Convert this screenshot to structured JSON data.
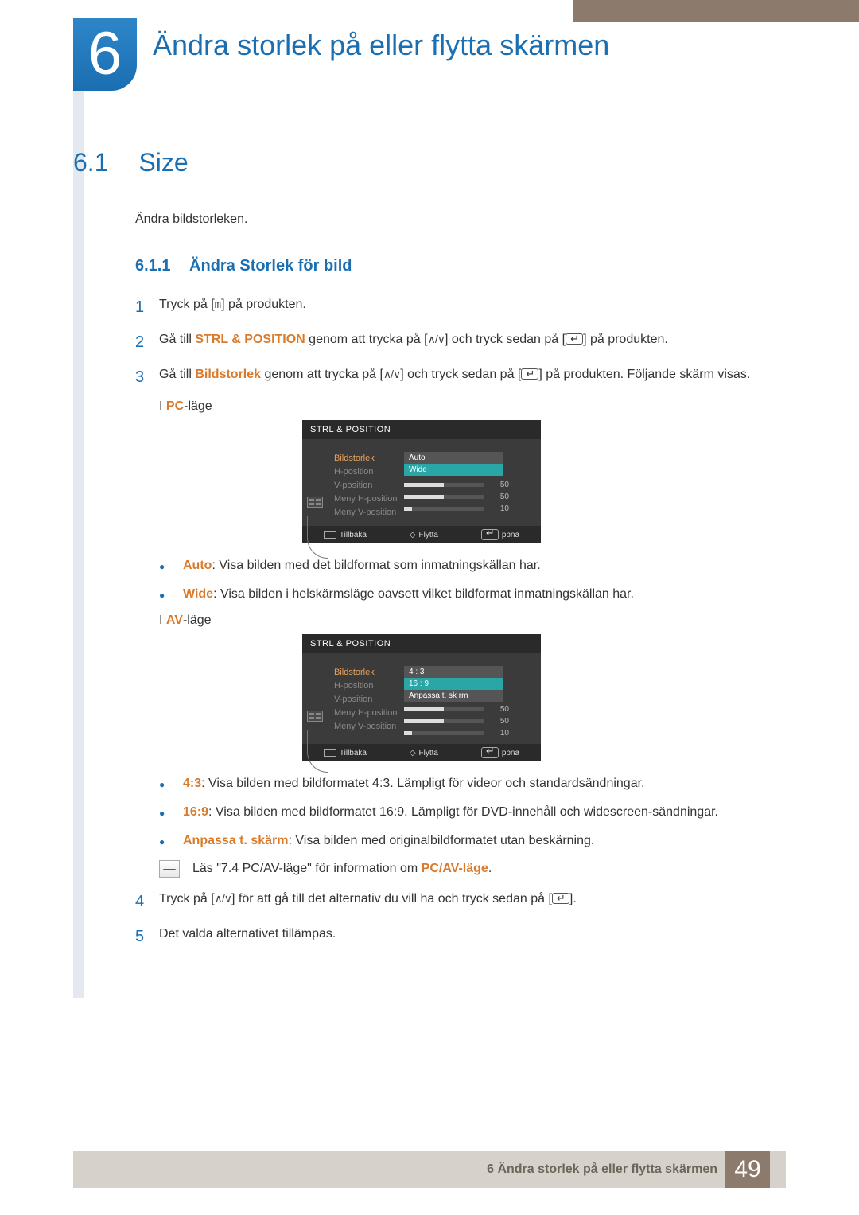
{
  "chapter": {
    "number": "6",
    "title": "Ändra storlek på eller flytta skärmen"
  },
  "section": {
    "number": "6.1",
    "title": "Size",
    "intro": "Ändra bildstorleken."
  },
  "subsection": {
    "number": "6.1.1",
    "title": "Ändra Storlek för bild"
  },
  "steps": {
    "s1": {
      "num": "1",
      "pre": "Tryck på [",
      "key": "m",
      "post": "] på produkten."
    },
    "s2": {
      "num": "2",
      "pre": "Gå till ",
      "hl": "STRL & POSITION",
      "mid": " genom att trycka på [",
      "mid2": "] och tryck sedan på [",
      "post": "] på produkten."
    },
    "s3": {
      "num": "3",
      "pre": "Gå till ",
      "hl": "Bildstorlek",
      "mid": " genom att trycka på [",
      "mid2": "] och tryck sedan på [",
      "post": "] på produkten. Följande skärm visas."
    },
    "mode_pc_pre": "I ",
    "mode_pc_hl": "PC",
    "mode_pc_post": "-läge",
    "mode_av_pre": "I ",
    "mode_av_hl": "AV",
    "mode_av_post": "-läge",
    "s4": {
      "num": "4",
      "pre": "Tryck på [",
      "mid": "] för att gå till det alternativ du vill ha och tryck sedan på [",
      "post": "]."
    },
    "s5": {
      "num": "5",
      "text": "Det valda alternativet tillämpas."
    }
  },
  "osd_pc": {
    "title": "STRL & POSITION",
    "labels": [
      "Bildstorlek",
      "H-position",
      "V-position",
      "Meny H-position",
      "Meny V-position"
    ],
    "options": [
      "Auto",
      "Wide"
    ],
    "sliders": [
      {
        "fill": 50,
        "val": "50"
      },
      {
        "fill": 50,
        "val": "50"
      },
      {
        "fill": 10,
        "val": "10"
      }
    ],
    "footer": [
      "Tillbaka",
      "Flytta",
      "ppna"
    ]
  },
  "osd_av": {
    "title": "STRL & POSITION",
    "labels": [
      "Bildstorlek",
      "H-position",
      "V-position",
      "Meny H-position",
      "Meny V-position"
    ],
    "options": [
      "4 : 3",
      "16 : 9",
      "Anpassa t. sk rm"
    ],
    "sliders": [
      {
        "fill": 50,
        "val": "50"
      },
      {
        "fill": 50,
        "val": "50"
      },
      {
        "fill": 10,
        "val": "10"
      }
    ],
    "footer": [
      "Tillbaka",
      "Flytta",
      "ppna"
    ]
  },
  "bullets_pc": {
    "b1": {
      "hl": "Auto",
      "text": ": Visa bilden med det bildformat som inmatningskällan har."
    },
    "b2": {
      "hl": "Wide",
      "text": ": Visa bilden i helskärmsläge oavsett vilket bildformat inmatningskällan har."
    }
  },
  "bullets_av": {
    "b1": {
      "hl": "4:3",
      "text": ": Visa bilden med bildformatet 4:3. Lämpligt för videor och standardsändningar."
    },
    "b2": {
      "hl": "16:9",
      "text": ": Visa bilden med bildformatet 16:9. Lämpligt för DVD-innehåll och widescreen-sändningar."
    },
    "b3": {
      "hl": "Anpassa t. skärm",
      "text": ": Visa bilden med originalbildformatet utan beskärning."
    }
  },
  "info_line": {
    "pre": "Läs \"7.4 PC/AV-läge\" för information om ",
    "hl": "PC/AV-läge",
    "post": "."
  },
  "footer": {
    "text": "6 Ändra storlek på eller flytta skärmen",
    "page": "49"
  }
}
